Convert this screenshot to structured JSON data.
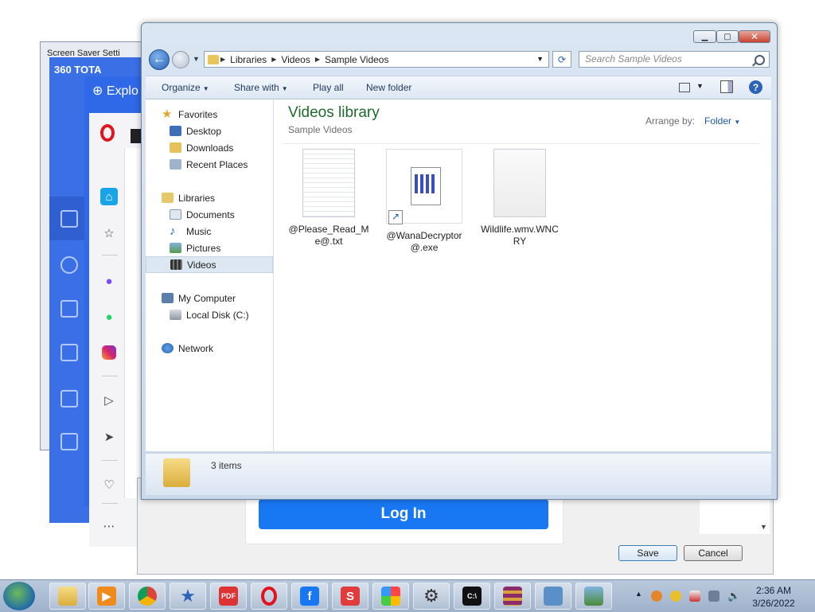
{
  "background_windows": {
    "screensaver_title": "Screen Saver Setti",
    "total_title": "360 TOTA",
    "explorer_title": "Explo",
    "login_button": "Log In",
    "save_button": "Save",
    "cancel_button": "Cancel"
  },
  "window": {
    "address": [
      "Libraries",
      "Videos",
      "Sample Videos"
    ],
    "search_placeholder": "Search Sample Videos",
    "toolbar": {
      "organize": "Organize",
      "share_with": "Share with",
      "play_all": "Play all",
      "new_folder": "New folder"
    },
    "nav": {
      "favorites": "Favorites",
      "desktop": "Desktop",
      "downloads": "Downloads",
      "recent_places": "Recent Places",
      "libraries": "Libraries",
      "documents": "Documents",
      "music": "Music",
      "pictures": "Pictures",
      "videos": "Videos",
      "my_computer": "My Computer",
      "local_disk": "Local Disk (C:)",
      "network": "Network"
    },
    "library_title": "Videos library",
    "library_subtitle": "Sample Videos",
    "arrange_by_label": "Arrange by:",
    "arrange_by_value": "Folder",
    "files": [
      {
        "name": "@Please_Read_Me@.txt",
        "icon": "text-file-icon"
      },
      {
        "name": "@WanaDecryptor@.exe",
        "icon": "exe-shortcut-icon"
      },
      {
        "name": "Wildlife.wmv.WNCRY",
        "icon": "blank-file-icon"
      }
    ],
    "status": "3 items"
  },
  "taskbar": {
    "apps": [
      "windows-explorer",
      "media-player",
      "chrome",
      "favorites-star",
      "pdf",
      "opera",
      "facebook",
      "s-app",
      "colorful-app",
      "gear-app",
      "cmd",
      "winrar",
      "network-tool",
      "monitor-tool"
    ],
    "clock_time": "2:36 AM",
    "clock_date": "3/26/2022"
  }
}
